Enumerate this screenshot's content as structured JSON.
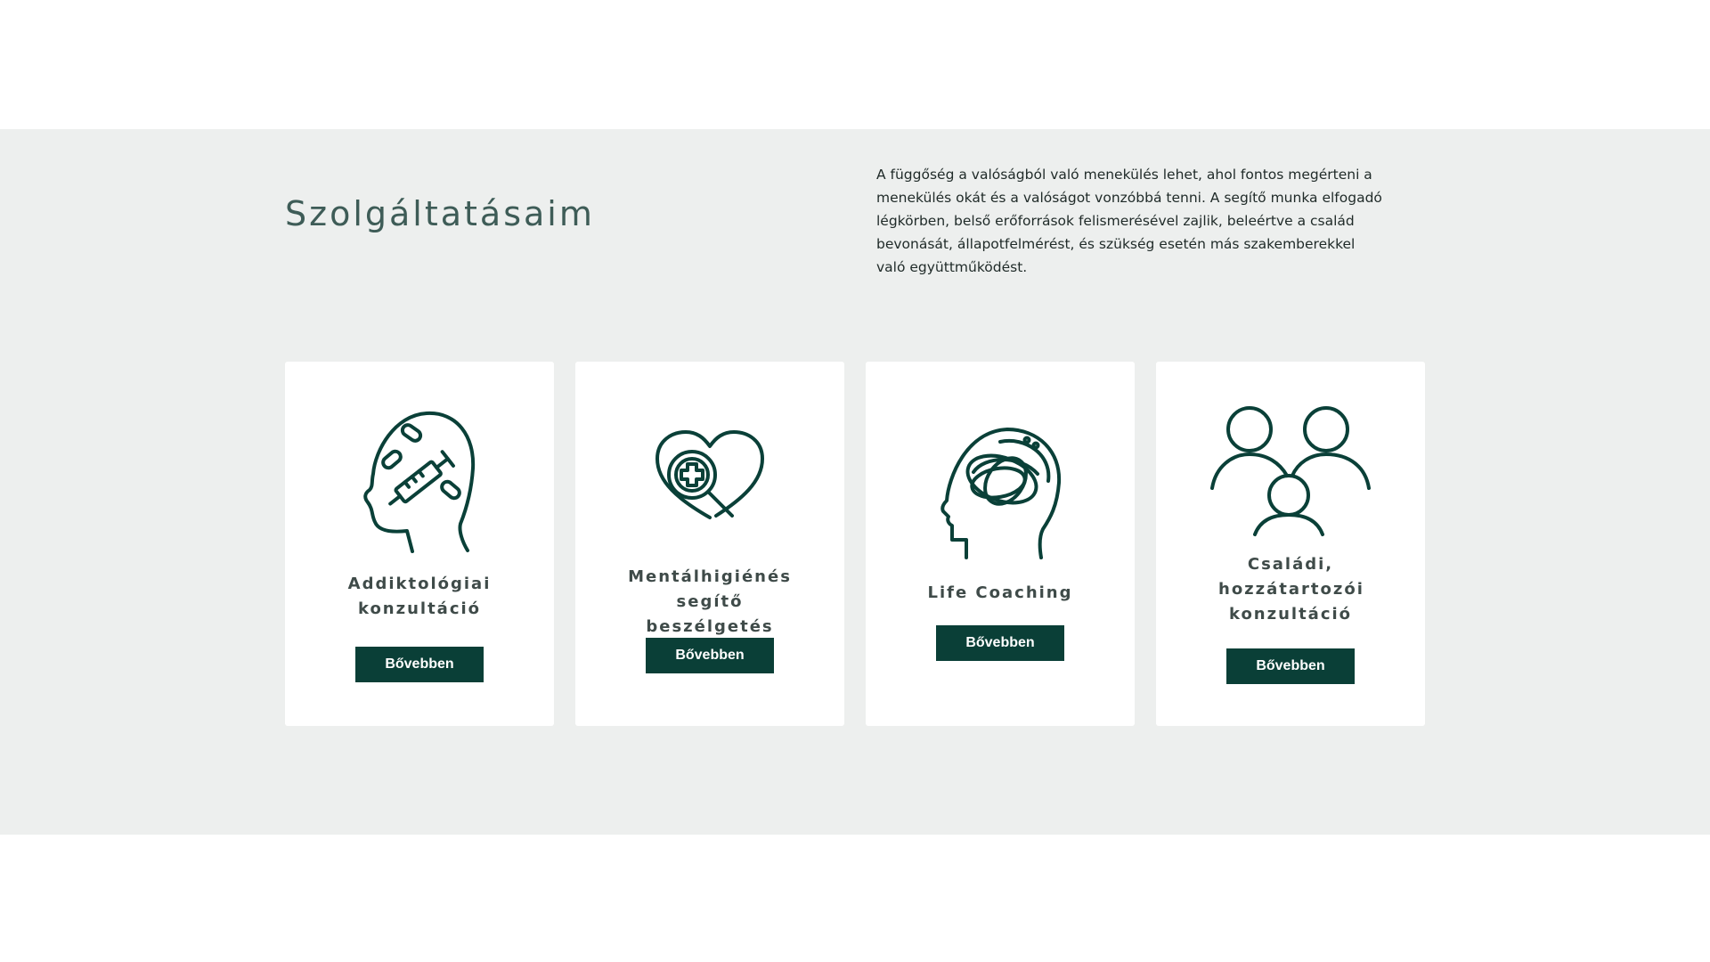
{
  "services": {
    "heading": "Szolgáltatásaim",
    "intro": "A függőség a valóságból való menekülés lehet, ahol fontos megérteni a menekülés okát és a valóságot vonzóbbá tenni. A segítő munka elfogadó légkörben, belső erőforrások felismerésével zajlik, beleértve a család bevonását, állapotfelmérést, és szükség esetén más szakemberekkel való együttműködést.",
    "cards": [
      {
        "title": "Addiktológiai konzultáció",
        "button": "Bővebben",
        "icon": "head-syringe-pills-icon"
      },
      {
        "title": "Mentálhigiénés segítő beszélgetés",
        "button": "Bővebben",
        "icon": "heart-magnifier-icon"
      },
      {
        "title": "Life Coaching",
        "button": "Bővebben",
        "icon": "head-scribble-icon"
      },
      {
        "title": "Családi, hozzátartozói konzultáció",
        "button": "Bővebben",
        "icon": "family-group-icon"
      }
    ]
  },
  "colors": {
    "section_bg": "#edefee",
    "accent": "#0a3f37",
    "heading": "#3e5c57"
  }
}
